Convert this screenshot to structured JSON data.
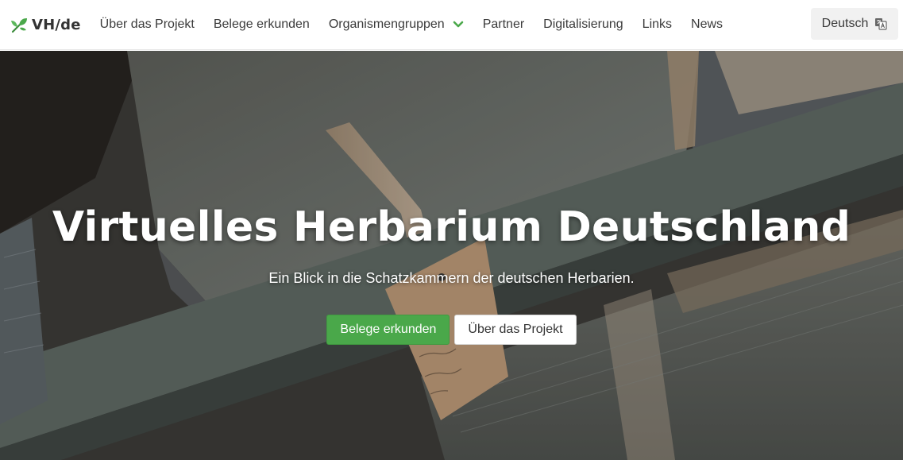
{
  "brand": {
    "label": "VH/de",
    "icon": "leaf-icon",
    "color": "#4aa84a"
  },
  "nav": {
    "items": [
      {
        "label": "Über das Projekt"
      },
      {
        "label": "Belege erkunden"
      },
      {
        "label": "Organismengruppen",
        "icon": "chevron-down-icon"
      },
      {
        "label": "Partner"
      },
      {
        "label": "Digitalisierung"
      },
      {
        "label": "Links"
      },
      {
        "label": "News"
      }
    ]
  },
  "language": {
    "label": "Deutsch",
    "icon": "translate-icon"
  },
  "hero": {
    "title": "Virtuelles Herbarium Deutschland",
    "subtitle": "Ein Blick in die Schatzkammern der deutschen Herbarien.",
    "primary_button": "Belege erkunden",
    "secondary_button": "Über das Projekt"
  },
  "colors": {
    "accent": "#4aa84a",
    "nav_text": "#3b3b3b"
  }
}
